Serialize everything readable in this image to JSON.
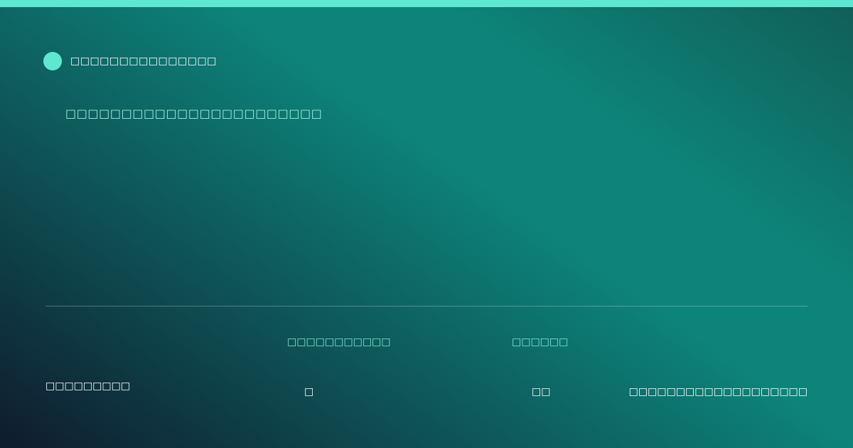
{
  "colors": {
    "accent": "#5ee8d2",
    "headline": "#9ff0e2",
    "stat_label": "#7fe9d7",
    "text": "#ffffff"
  },
  "brand": {
    "icon": "circle-logo-icon",
    "name": "□□□□□□□□□□□□□□□"
  },
  "hero": {
    "headline": "□□□□□□□□□□□□□□□□□□□□□□□"
  },
  "footer": {
    "left_text": "□□□□□□□□□",
    "stats": [
      {
        "label": "□□□□□□□□□□□",
        "value": "□"
      },
      {
        "label": "□□□□□□",
        "value": "□□"
      }
    ],
    "right_text": "□□□□□□□□□□□□□□□□□□□"
  }
}
